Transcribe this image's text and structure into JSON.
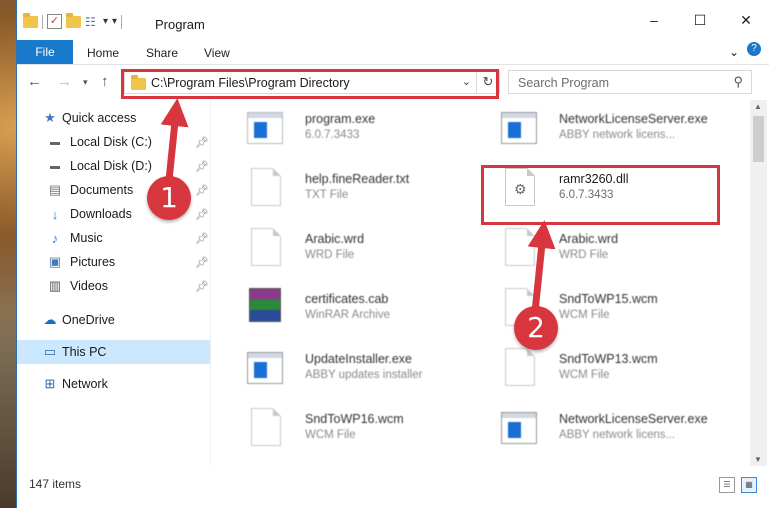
{
  "window": {
    "title": "Program",
    "controls": [
      "–",
      "☐",
      "✕"
    ]
  },
  "ribbon": {
    "tabs": [
      "File",
      "Home",
      "Share",
      "View"
    ]
  },
  "address": {
    "path": "C:\\Program Files\\Program Directory",
    "search_placeholder": "Search Program"
  },
  "sidebar": {
    "items": [
      {
        "label": "Quick access",
        "icon": "star-icon"
      },
      {
        "label": "Local Disk (C:)",
        "icon": "drive-icon",
        "pinned": true
      },
      {
        "label": "Local Disk (D:)",
        "icon": "drive-icon",
        "pinned": true
      },
      {
        "label": "Documents",
        "icon": "documents-icon",
        "pinned": true
      },
      {
        "label": "Downloads",
        "icon": "download-arrow-icon",
        "pinned": true
      },
      {
        "label": "Music",
        "icon": "music-note-icon",
        "pinned": true
      },
      {
        "label": "Pictures",
        "icon": "pictures-icon",
        "pinned": true
      },
      {
        "label": "Videos",
        "icon": "videos-icon",
        "pinned": true
      },
      {
        "label": "OneDrive",
        "icon": "cloud-icon"
      },
      {
        "label": "This PC",
        "icon": "monitor-icon",
        "selected": true
      },
      {
        "label": "Network",
        "icon": "network-icon"
      }
    ]
  },
  "files": [
    {
      "name": "program.exe",
      "sub": "6.0.7.3433",
      "icon": "installer-icon"
    },
    {
      "name": "NetworkLicenseServer.exe",
      "sub": "ABBY network licens...",
      "icon": "exe-window-icon"
    },
    {
      "name": "help.fineReader.txt",
      "sub": "TXT File",
      "icon": "document-icon"
    },
    {
      "name": "ramr3260.dll",
      "sub": "6.0.7.3433",
      "icon": "dll-gear-icon"
    },
    {
      "name": "Arabic.wrd",
      "sub": "WRD File",
      "icon": "document-icon"
    },
    {
      "name": "Arabic.wrd",
      "sub": "WRD File",
      "icon": "document-icon"
    },
    {
      "name": "certificates.cab",
      "sub": "WinRAR Archive",
      "icon": "winrar-icon"
    },
    {
      "name": "SndToWP15.wcm",
      "sub": "WCM File",
      "icon": "document-icon"
    },
    {
      "name": "UpdateInstaller.exe",
      "sub": "ABBY updates installer",
      "icon": "exe-window-icon"
    },
    {
      "name": "SndToWP13.wcm",
      "sub": "WCM File",
      "icon": "document-icon"
    },
    {
      "name": "SndToWP16.wcm",
      "sub": "WCM File",
      "icon": "document-icon"
    },
    {
      "name": "NetworkLicenseServer.exe",
      "sub": "ABBY network licens...",
      "icon": "exe-window-icon"
    }
  ],
  "status": {
    "items_count": "147 items"
  },
  "annotations": {
    "marker_1": "1",
    "marker_2": "2",
    "color": "#d8363f"
  }
}
